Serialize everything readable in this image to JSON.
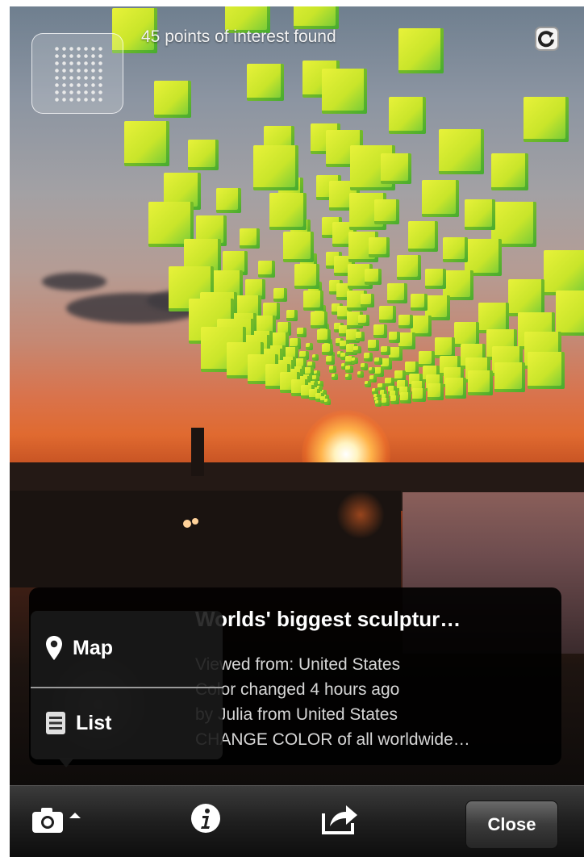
{
  "header": {
    "poi_count_text": "45 points of interest found",
    "radar_icon": "radar-dots-icon",
    "refresh_icon": "refresh-icon"
  },
  "info_card": {
    "title": "Worlds' biggest sculptur…",
    "lines": [
      "Viewed from: United States",
      "Color changed 4 hours ago",
      "by Julia from United States",
      "CHANGE COLOR of all worldwide…"
    ]
  },
  "view_menu": {
    "items": [
      {
        "label": "Map",
        "icon": "map-pin-icon"
      },
      {
        "label": "List",
        "icon": "list-icon"
      }
    ]
  },
  "toolbar": {
    "camera_icon": "camera-icon",
    "info_icon": "info-icon",
    "share_icon": "share-icon",
    "close_label": "Close"
  },
  "colors": {
    "cube_top": "#e8f23a",
    "cube_side": "#6cc83a",
    "toolbar_bg": "#1f1f1f",
    "card_bg": "#000000"
  }
}
